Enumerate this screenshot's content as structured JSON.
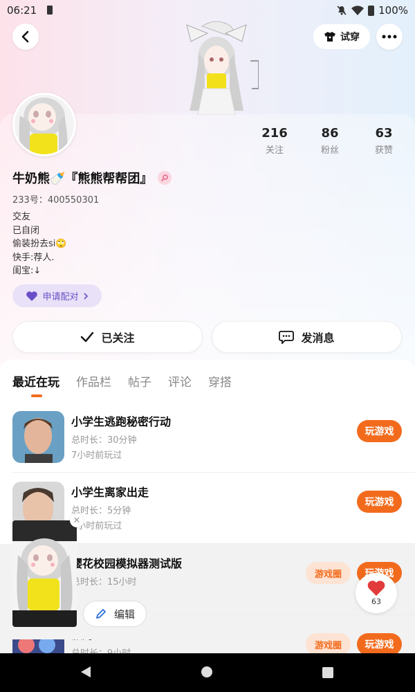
{
  "status_bar": {
    "time": "06:21",
    "battery": "100%"
  },
  "header": {
    "try_on_label": "试穿"
  },
  "stats": [
    {
      "num": "216",
      "label": "关注"
    },
    {
      "num": "86",
      "label": "粉丝"
    },
    {
      "num": "63",
      "label": "获赞"
    }
  ],
  "profile": {
    "name": "牛奶熊🍼『熊熊帮帮团』",
    "uid": "233号：400550301",
    "bio": [
      "交友",
      "已自闭",
      "偷装扮去si🙄",
      "快手:荐人.",
      "闺宝:↓"
    ],
    "pair_label": "申请配对"
  },
  "actions": {
    "following_label": "已关注",
    "message_label": "发消息"
  },
  "tabs": [
    "最近在玩",
    "作品栏",
    "帖子",
    "评论",
    "穿搭"
  ],
  "games": [
    {
      "title": "小学生逃跑秘密行动",
      "duration": "总时长：30分钟",
      "last": "7小时前玩过",
      "play": "玩游戏"
    },
    {
      "title": "小学生离家出走",
      "duration": "总时长：5分钟",
      "last": "7小时前玩过",
      "play": "玩游戏"
    },
    {
      "title": "樱花校园模拟器测试版",
      "duration": "总时长：15小时",
      "circle": "游戏圈",
      "play": "玩游戏"
    },
    {
      "title": "派对",
      "duration": "总时长：9小时",
      "circle": "游戏圈",
      "play": "玩游戏"
    }
  ],
  "floating": {
    "edit_label": "编辑"
  },
  "like": {
    "count": "63"
  },
  "colors": {
    "accent": "#f26b1d",
    "pair": "#6a4ec7"
  }
}
